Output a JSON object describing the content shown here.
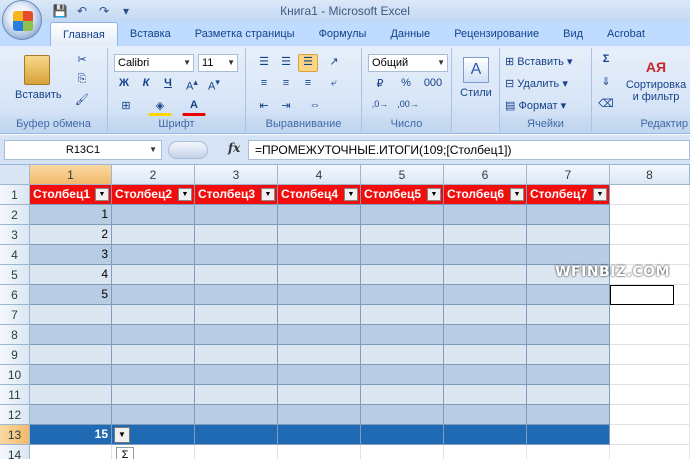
{
  "window": {
    "title": "Книга1 - Microsoft Excel"
  },
  "tabs": [
    "Главная",
    "Вставка",
    "Разметка страницы",
    "Формулы",
    "Данные",
    "Рецензирование",
    "Вид",
    "Acrobat"
  ],
  "ribbon": {
    "clipboard": {
      "paste": "Вставить",
      "label": "Буфер обмена"
    },
    "font": {
      "name": "Calibri",
      "size": "11",
      "bold": "Ж",
      "italic": "К",
      "underline": "Ч",
      "label": "Шрифт"
    },
    "alignment": {
      "label": "Выравнивание"
    },
    "number": {
      "format": "Общий",
      "percent": "%",
      "thousands": "000",
      "label": "Число"
    },
    "styles": {
      "label": "Стили"
    },
    "cells": {
      "insert": "Вставить",
      "delete": "Удалить",
      "format": "Формат",
      "label": "Ячейки"
    },
    "editing": {
      "sort": "Сортировка",
      "sort2": "и фильтр",
      "label": "Редактир"
    }
  },
  "formula_bar": {
    "name_box": "R13C1",
    "fx": "fx",
    "formula": "=ПРОМЕЖУТОЧНЫЕ.ИТОГИ(109;[Столбец1])"
  },
  "grid": {
    "columns": [
      "1",
      "2",
      "3",
      "4",
      "5",
      "6",
      "7",
      "8"
    ],
    "rows": [
      "1",
      "2",
      "3",
      "4",
      "5",
      "6",
      "7",
      "8",
      "9",
      "10",
      "11",
      "12",
      "13",
      "14"
    ],
    "table_headers": [
      "Столбец1",
      "Столбец2",
      "Столбец3",
      "Столбец4",
      "Столбец5",
      "Столбец6",
      "Столбец7"
    ],
    "values_col1": [
      "1",
      "2",
      "3",
      "4",
      "5"
    ],
    "total": "15",
    "sigma": "Σ"
  },
  "watermark": "WFINBIZ.COM"
}
